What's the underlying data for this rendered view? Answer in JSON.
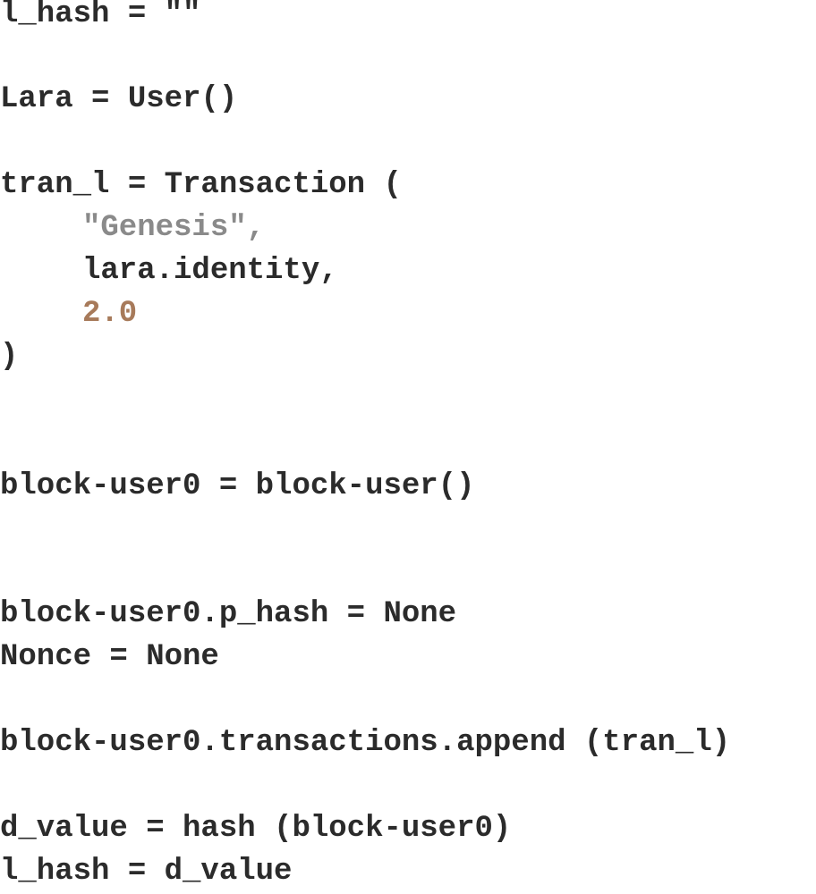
{
  "code": {
    "lines": [
      "l_hash = \"\"",
      "Lara = User()",
      "tran_l = Transaction (",
      "\"Genesis\",",
      "lara.identity,",
      "2.0",
      ")",
      "block-user0 = block-user()",
      "block-user0.p_hash = None",
      "Nonce = None",
      "block-user0.transactions.append (tran_l)",
      "d_value = hash (block-user0)",
      "l_hash = d_value"
    ]
  },
  "colors": {
    "text": "#2b2b2b",
    "string": "#8a8a8a",
    "number": "#a77a5a",
    "background": "#ffffff"
  }
}
